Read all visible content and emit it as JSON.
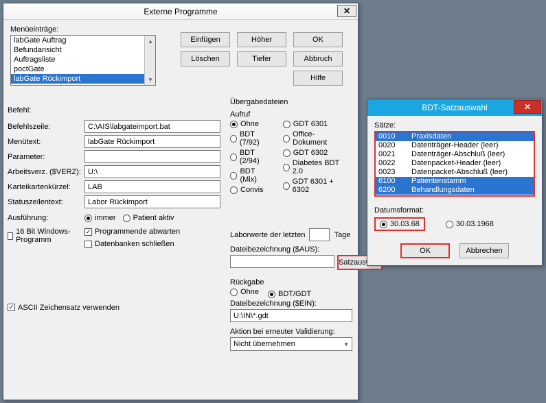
{
  "main": {
    "title": "Externe Programme",
    "menuentries_label": "Menüeinträge:",
    "list": [
      "labGate Auftrag",
      "Befundansicht",
      "Auftragsliste",
      "poctGate",
      "labGate Rückimport"
    ],
    "selected_index": 4,
    "buttons": {
      "einfuegen": "Einfügen",
      "hoeher": "Höher",
      "ok": "OK",
      "loeschen": "Löschen",
      "tiefer": "Tiefer",
      "abbruch": "Abbruch",
      "hilfe": "Hilfe"
    },
    "befehl_label": "Befehl:",
    "fields": {
      "befehlszeile": {
        "label": "Befehlszeile:",
        "value": "C:\\AIS\\labgateimport.bat"
      },
      "menuetext": {
        "label": "Menütext:",
        "value": "labGate Rückimport"
      },
      "parameter": {
        "label": "Parameter:",
        "value": ""
      },
      "arbeitsverz": {
        "label": "Arbeitsverz. ($VERZ):",
        "value": "U:\\"
      },
      "karteikarten": {
        "label": "Karteikartenkürzel:",
        "value": "LAB"
      },
      "statuszeile": {
        "label": "Statuszeilentext:",
        "value": "Labor Rückimport"
      }
    },
    "ausfuehrung": {
      "label": "Ausführung:",
      "options": [
        "immer",
        "Patient aktiv"
      ],
      "selected": "immer"
    },
    "checks": {
      "bit16": {
        "label": "16 Bit Windows-Programm",
        "checked": false
      },
      "progende": {
        "label": "Programmende abwarten",
        "checked": true
      },
      "dbclose": {
        "label": "Datenbanken schließen",
        "checked": false
      },
      "ascii": {
        "label": "ASCII Zeichensatz verwenden",
        "checked": true
      }
    },
    "uebergabe": {
      "label": "Übergabedateien",
      "aufruf_label": "Aufruf",
      "options_col1": [
        "Ohne",
        "BDT (7/92)",
        "BDT (2/94)",
        "BDT (Mix)",
        "Convis"
      ],
      "options_col2": [
        "GDT 6301",
        "Office-Dokument",
        "GDT 6302",
        "Diabetes BDT 2.0",
        "GDT 6301 + 6302"
      ],
      "selected": "Ohne",
      "laborwerte_label": "Laborwerte der letzten",
      "tage_label": "Tage",
      "dateibez_label": "Dateibezeichnung ($AUS):",
      "satzauswahl": "Satzauswahl",
      "rueckgabe_label": "Rückgabe",
      "rueckgabe_options": [
        "Ohne",
        "BDT/GDT"
      ],
      "rueckgabe_selected": "BDT/GDT",
      "dateibez_ein_label": "Dateibezeichnung ($EIN):",
      "dateibez_ein_value": "U:\\IN\\*.gdt",
      "aktion_label": "Aktion bei erneuter Validierung:",
      "aktion_value": "Nicht übernehmen"
    }
  },
  "sub": {
    "title": "BDT-Satzauswahl",
    "saetze_label": "Sätze:",
    "rows": [
      {
        "code": "0010",
        "text": "Praxisdaten",
        "sel": true
      },
      {
        "code": "0020",
        "text": "Datenträger-Header (leer)",
        "sel": false
      },
      {
        "code": "0021",
        "text": "Datenträger-Abschluß (leer)",
        "sel": false
      },
      {
        "code": "0022",
        "text": "Datenpacket-Header (leer)",
        "sel": false
      },
      {
        "code": "0023",
        "text": "Datenpacket-Abschluß (leer)",
        "sel": false
      },
      {
        "code": "6100",
        "text": "Patientenstamm",
        "sel": true
      },
      {
        "code": "6200",
        "text": "Behandlungsdaten",
        "sel": true
      }
    ],
    "datum_label": "Datumsformat:",
    "datum_options": [
      "30.03.68",
      "30.03.1968"
    ],
    "datum_selected": "30.03.68",
    "ok": "OK",
    "abbrechen": "Abbrechen"
  }
}
